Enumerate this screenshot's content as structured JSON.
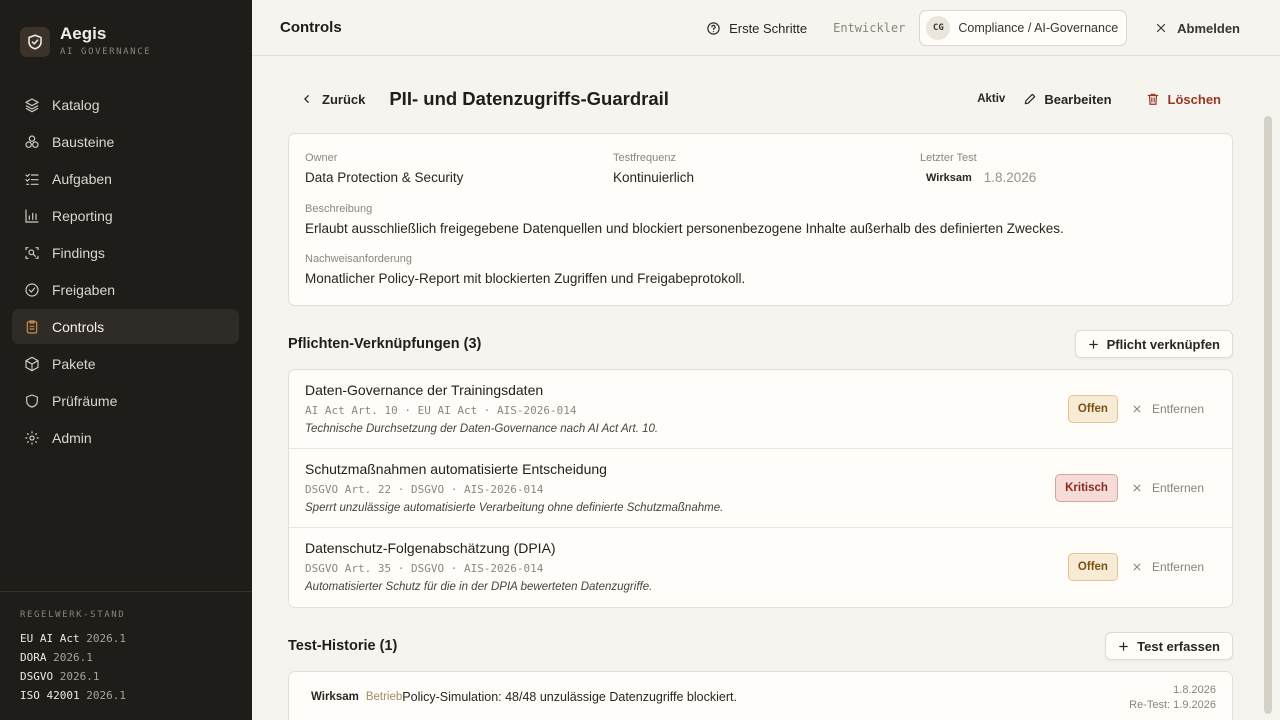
{
  "brand": {
    "name": "Aegis",
    "subtitle": "AI GOVERNANCE"
  },
  "sidebar": {
    "items": [
      {
        "label": "Katalog",
        "icon": "layers-icon"
      },
      {
        "label": "Bausteine",
        "icon": "blocks-icon"
      },
      {
        "label": "Aufgaben",
        "icon": "tasks-icon"
      },
      {
        "label": "Reporting",
        "icon": "chart-icon"
      },
      {
        "label": "Findings",
        "icon": "scan-icon"
      },
      {
        "label": "Freigaben",
        "icon": "check-circle-icon"
      },
      {
        "label": "Controls",
        "icon": "clipboard-icon",
        "active": true
      },
      {
        "label": "Pakete",
        "icon": "package-icon"
      },
      {
        "label": "Prüfräume",
        "icon": "shield-icon"
      },
      {
        "label": "Admin",
        "icon": "gear-icon"
      }
    ],
    "footer": {
      "title": "REGELWERK-STAND",
      "regs": [
        {
          "name": "EU AI Act",
          "version": "2026.1"
        },
        {
          "name": "DORA",
          "version": "2026.1"
        },
        {
          "name": "DSGVO",
          "version": "2026.1"
        },
        {
          "name": "ISO 42001",
          "version": "2026.1"
        }
      ]
    }
  },
  "topbar": {
    "title": "Controls",
    "help": "Erste Schritte",
    "dev": "Entwickler",
    "tenant_initials": "CG",
    "tenant": "Compliance / AI-Governance",
    "logout": "Abmelden"
  },
  "control": {
    "back": "Zurück",
    "title": "PII- und Datenzugriffs-Guardrail",
    "status": "Aktiv",
    "edit": "Bearbeiten",
    "delete": "Löschen",
    "owner_label": "Owner",
    "owner": "Data Protection & Security",
    "freq_label": "Testfrequenz",
    "freq": "Kontinuierlich",
    "last_test_label": "Letzter Test",
    "last_test_state": "Wirksam",
    "last_test_date": "1.8.2026",
    "desc_label": "Beschreibung",
    "desc": "Erlaubt ausschließlich freigegebene Datenquellen und blockiert personenbezogene Inhalte außerhalb des definierten Zweckes.",
    "evidence_label": "Nachweisanforderung",
    "evidence": "Monatlicher Policy-Report mit blockierten Zugriffen und Freigabeprotokoll."
  },
  "duties": {
    "title": "Pflichten-Verknüpfungen (3)",
    "link_button": "Pflicht verknüpfen",
    "remove_label": "Entfernen",
    "items": [
      {
        "title": "Daten-Governance der Trainingsdaten",
        "meta": "AI Act Art. 10 · EU AI Act · AIS-2026-014",
        "desc": "Technische Durchsetzung der Daten-Governance nach AI Act Art. 10.",
        "badge": "Offen"
      },
      {
        "title": "Schutzmaßnahmen automatisierte Entscheidung",
        "meta": "DSGVO Art. 22 · DSGVO · AIS-2026-014",
        "desc": "Sperrt unzulässige automatisierte Verarbeitung ohne definierte Schutzmaßnahme.",
        "badge": "Kritisch"
      },
      {
        "title": "Datenschutz-Folgenabschätzung (DPIA)",
        "meta": "DSGVO Art. 35 · DSGVO · AIS-2026-014",
        "desc": "Automatisierter Schutz für die in der DPIA bewerteten Datenzugriffe.",
        "badge": "Offen"
      }
    ]
  },
  "history": {
    "title": "Test-Historie (1)",
    "add_button": "Test erfassen",
    "items": [
      {
        "state": "Wirksam",
        "type": "Betrieb",
        "text": "Policy-Simulation: 48/48 unzulässige Datenzugriffe blockiert.",
        "date": "1.8.2026",
        "retest": "Re-Test: 1.9.2026"
      }
    ]
  },
  "colors": {
    "sidebar_bg": "#1f1d1a",
    "accent": "#c98a4b",
    "danger": "#9b3326",
    "page_bg": "#f6f4ef"
  }
}
